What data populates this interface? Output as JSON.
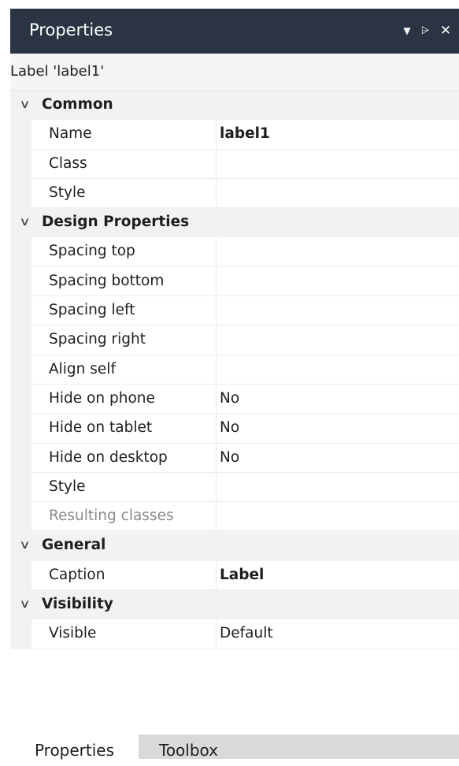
{
  "panel": {
    "title": "Properties",
    "controls": {
      "dropdown_icon": "▼",
      "pin_icon": "⩥",
      "close_icon": "✕"
    },
    "subject": "Label 'label1'"
  },
  "categories": [
    {
      "label": "Common",
      "chevron": "∨",
      "props": [
        {
          "name": "Name",
          "value": "label1",
          "bold": true
        },
        {
          "name": "Class",
          "value": ""
        },
        {
          "name": "Style",
          "value": ""
        }
      ]
    },
    {
      "label": "Design Properties",
      "chevron": "∨",
      "props": [
        {
          "name": "Spacing top",
          "value": ""
        },
        {
          "name": "Spacing bottom",
          "value": ""
        },
        {
          "name": "Spacing left",
          "value": ""
        },
        {
          "name": "Spacing right",
          "value": ""
        },
        {
          "name": "Align self",
          "value": ""
        },
        {
          "name": "Hide on phone",
          "value": "No"
        },
        {
          "name": "Hide on tablet",
          "value": "No"
        },
        {
          "name": "Hide on desktop",
          "value": "No"
        },
        {
          "name": "Style",
          "value": ""
        },
        {
          "name": "Resulting classes",
          "value": "",
          "muted": true
        }
      ]
    },
    {
      "label": "General",
      "chevron": "∨",
      "props": [
        {
          "name": "Caption",
          "value": "Label",
          "bold": true
        }
      ]
    },
    {
      "label": "Visibility",
      "chevron": "∨",
      "props": [
        {
          "name": "Visible",
          "value": "Default"
        }
      ]
    }
  ],
  "tabs": [
    {
      "label": "Properties",
      "active": true
    },
    {
      "label": "Toolbox",
      "active": false
    }
  ],
  "colors": {
    "titlebar_bg": "#2b3443",
    "category_bg": "#f2f2f2",
    "inactive_tab_bg": "#d9d9d9",
    "muted_text": "#8a8a8a"
  }
}
